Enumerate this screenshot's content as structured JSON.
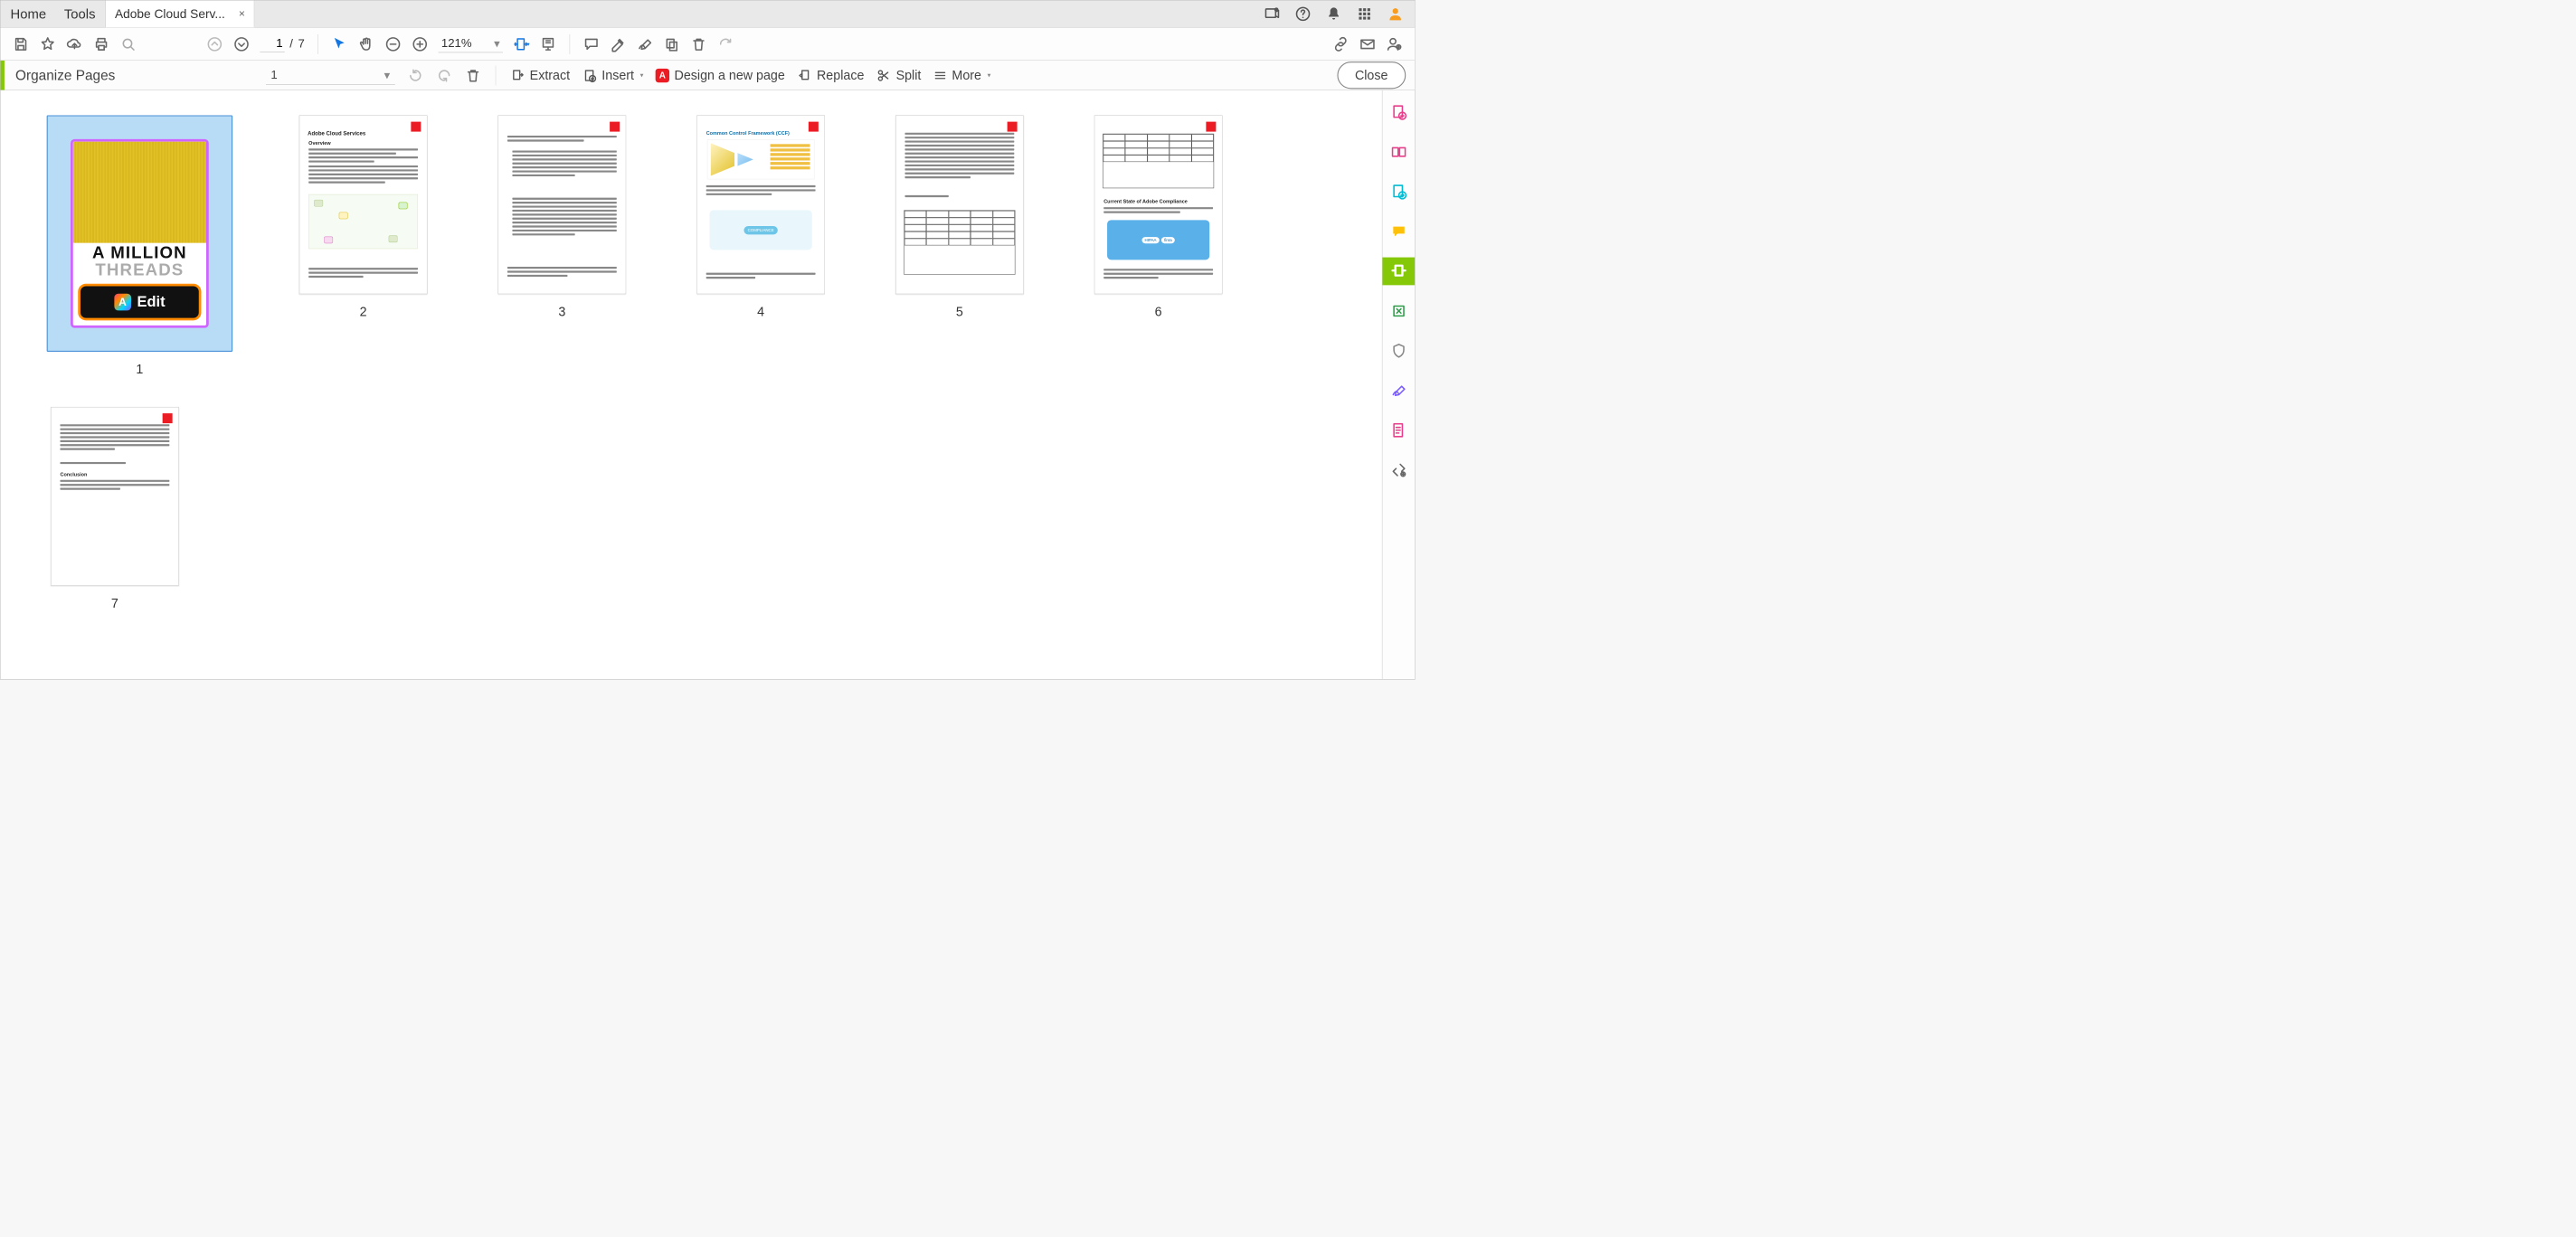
{
  "topnav": {
    "home": "Home",
    "tools": "Tools"
  },
  "tab": {
    "title": "Adobe Cloud Serv..."
  },
  "toolbar": {
    "current_page": "1",
    "page_sep": "/",
    "total_pages": "7",
    "zoom": "121%"
  },
  "orgbar": {
    "title": "Organize Pages",
    "page_dd_value": "1",
    "extract": "Extract",
    "insert": "Insert",
    "design": "Design a new page",
    "replace": "Replace",
    "split": "Split",
    "more": "More",
    "close": "Close"
  },
  "thumb1": {
    "title_line1": "A MILLION",
    "title_line2": "THREADS",
    "edit_label": "Edit",
    "label": "1"
  },
  "thumbs": {
    "p2": {
      "label": "2",
      "heading": "Adobe Cloud Services",
      "sub": "Overview"
    },
    "p3": {
      "label": "3"
    },
    "p4": {
      "label": "4",
      "ccf_title": "Common Control Framework (CCF)",
      "compliance_label": "COMPLIANCE"
    },
    "p5": {
      "label": "5"
    },
    "p6": {
      "label": "6",
      "section": "Current State of Adobe Compliance",
      "badge1": "HIPAA",
      "badge2": "finra"
    },
    "p7": {
      "label": "7",
      "section": "Conclusion"
    }
  }
}
